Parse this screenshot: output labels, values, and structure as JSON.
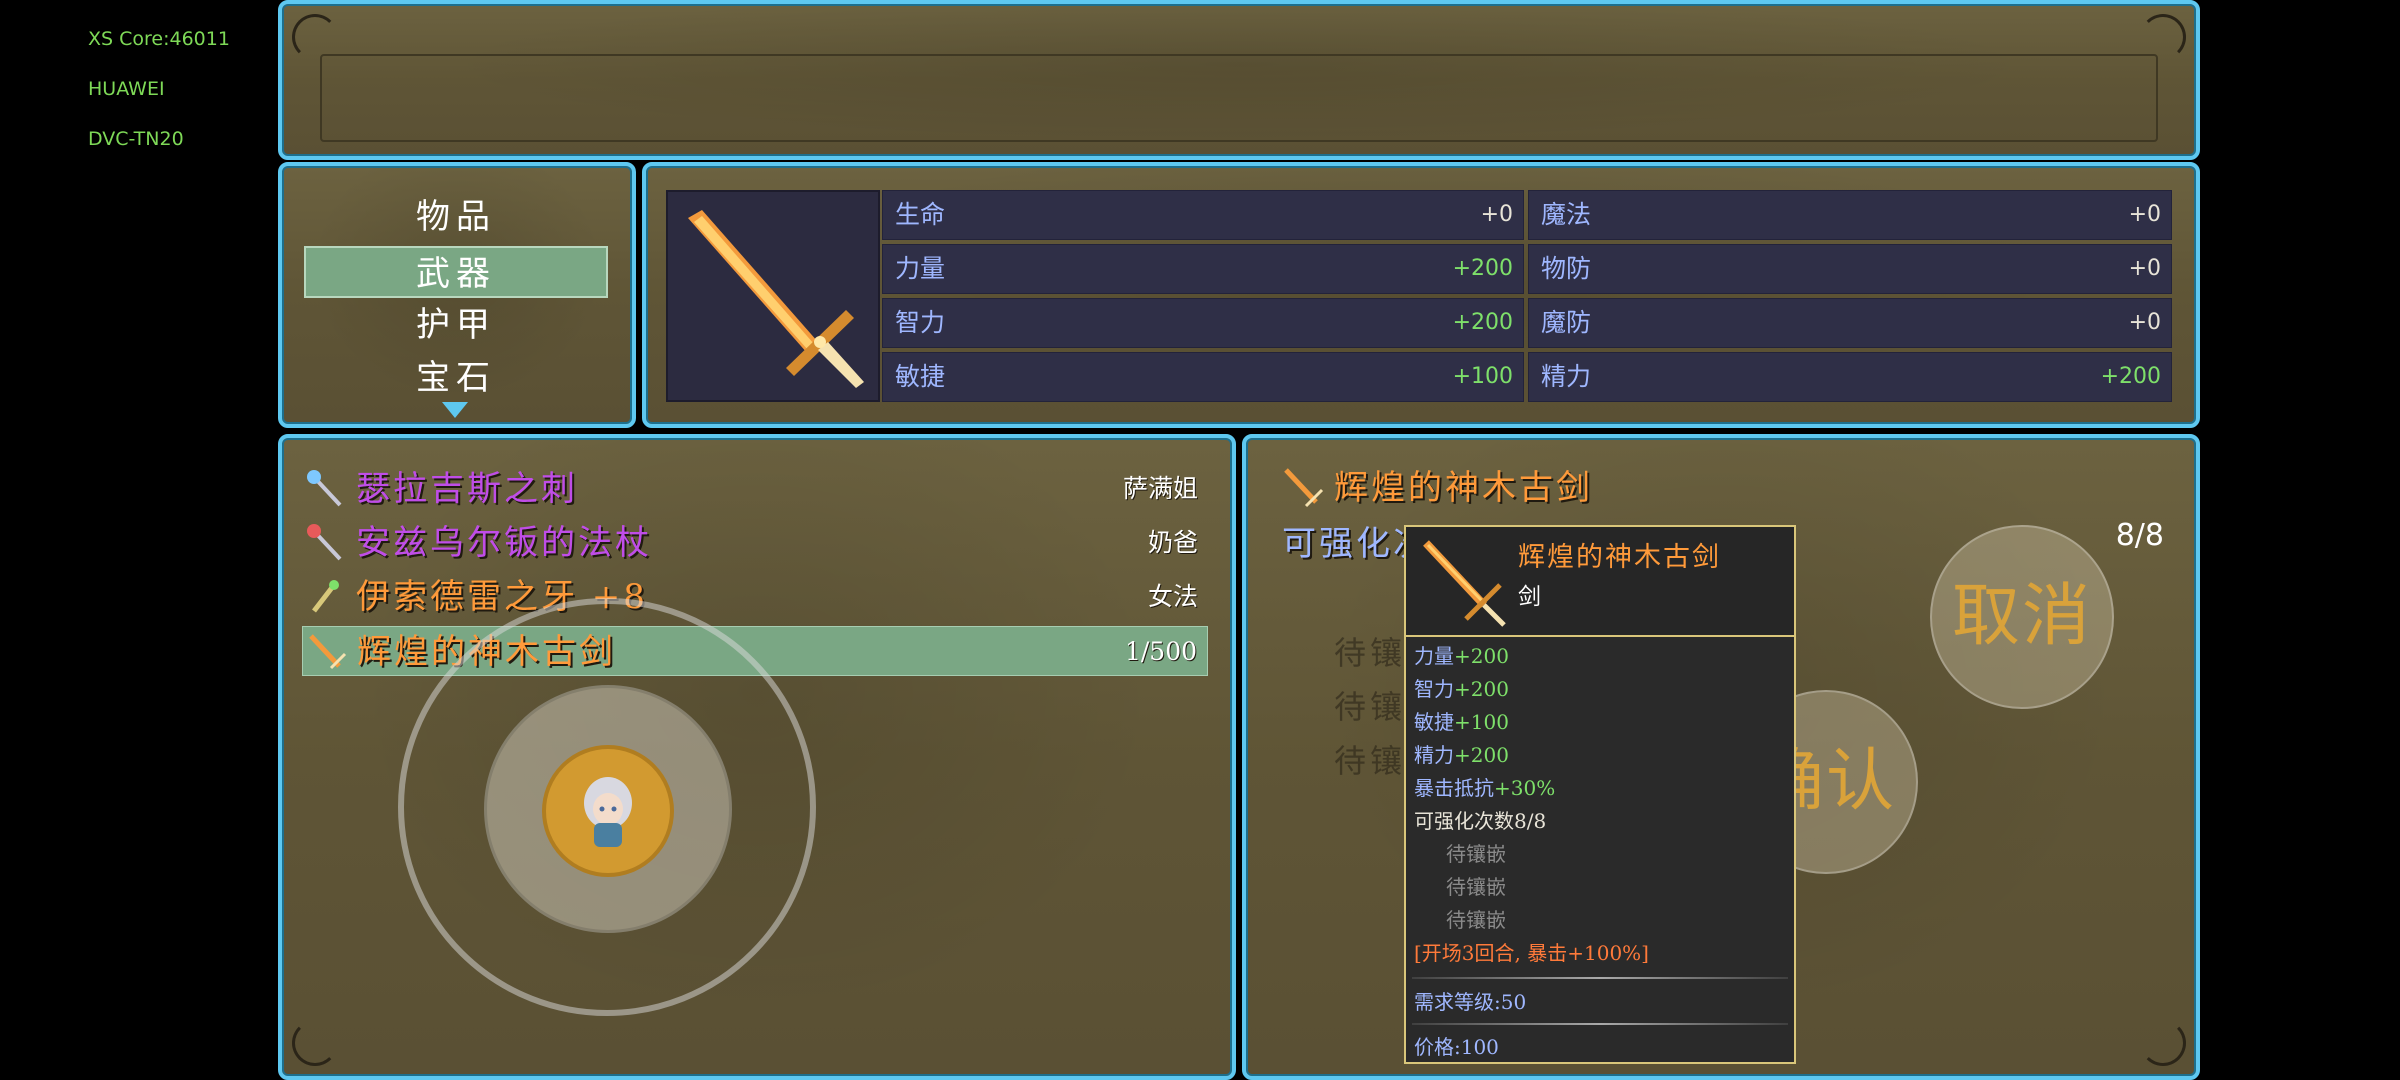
{
  "debug": [
    "XS Core:46011",
    "HUAWEI",
    "DVC-TN20"
  ],
  "tabs": [
    "物品",
    "武器",
    "护甲",
    "宝石"
  ],
  "active_tab": "武器",
  "stats": {
    "left": [
      {
        "label": "生命",
        "value": "+0"
      },
      {
        "label": "力量",
        "value": "+200"
      },
      {
        "label": "智力",
        "value": "+200"
      },
      {
        "label": "敏捷",
        "value": "+100"
      }
    ],
    "right": [
      {
        "label": "魔法",
        "value": "+0"
      },
      {
        "label": "物防",
        "value": "+0"
      },
      {
        "label": "魔防",
        "value": "+0"
      },
      {
        "label": "精力",
        "value": "+200"
      }
    ]
  },
  "inventory": [
    {
      "name": "瑟拉吉斯之刺",
      "tag": "萨满姐",
      "color": "#c04de8",
      "icon": "staff-icon"
    },
    {
      "name": "安兹乌尔钣的法杖",
      "tag": "奶爸",
      "color": "#c04de8",
      "icon": "staff-icon"
    },
    {
      "name": "伊索德雷之牙 +8",
      "tag": "女法",
      "color": "#ff9a3a",
      "icon": "dagger-icon"
    },
    {
      "name": "辉煌的神木古剑",
      "tag": "1/500",
      "color": "#ff9a3a",
      "icon": "sword-icon"
    }
  ],
  "detail": {
    "title": "辉煌的神木古剑",
    "enhance_label": "可强化次数",
    "enhance_count": "8/8",
    "pending": [
      "待镶嵌",
      "待镶嵌",
      "待镶嵌"
    ],
    "inlay_hint": "镶嵌"
  },
  "buttons": {
    "cancel": "取消",
    "confirm": "确认"
  },
  "tooltip": {
    "name": "辉煌的神木古剑",
    "type": "剑",
    "stats": [
      {
        "k": "力量",
        "v": "+200"
      },
      {
        "k": "智力",
        "v": "+200"
      },
      {
        "k": "敏捷",
        "v": "+100"
      },
      {
        "k": "精力",
        "v": "+200"
      },
      {
        "k": "暴击抵抗",
        "v": "+30%"
      }
    ],
    "enhance": "可强化次数8/8",
    "sockets": [
      "待镶嵌",
      "待镶嵌",
      "待镶嵌"
    ],
    "skill": "[开场3回合, 暴击+100%]",
    "level_req": "需求等级:50",
    "price": "价格:100"
  }
}
